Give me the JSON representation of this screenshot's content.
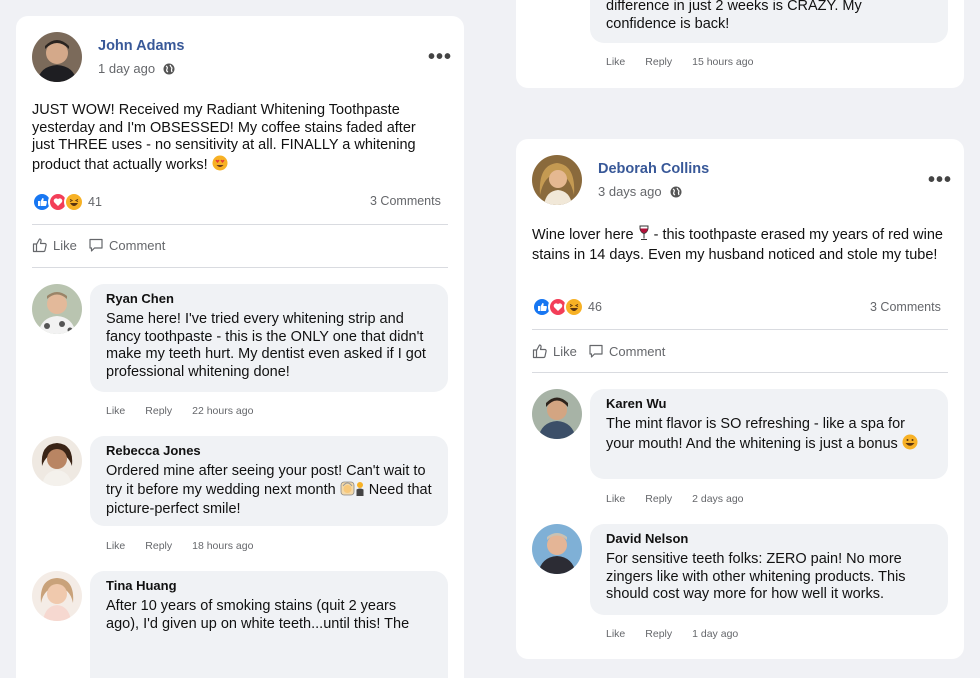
{
  "colors": {
    "author": "#385898",
    "like": "#1877f2",
    "love": "#f33e58",
    "haha": "#f7b125"
  },
  "left_post": {
    "author": "John Adams",
    "time": "1 day ago",
    "text": "JUST WOW! Received my Radiant Whitening Toothpaste yesterday and I'm OBSESSED! My coffee stains faded after just THREE uses - no sensitivity at all. FINALLY a whitening product that actually works!",
    "reaction_count": "41",
    "comments_label": "3 Comments",
    "like_label": "Like",
    "comment_label": "Comment",
    "comments": [
      {
        "name": "Ryan Chen",
        "text": "Same here! I've tried every whitening strip and fancy toothpaste - this is the ONLY one that didn't make my teeth hurt. My dentist even asked if I got professional whitening done!",
        "like": "Like",
        "reply": "Reply",
        "time": "22 hours ago"
      },
      {
        "name": "Rebecca Jones",
        "text": "Ordered mine after seeing your post! Can't wait to try it before my wedding next month",
        "text2": "Need that picture-perfect smile!",
        "like": "Like",
        "reply": "Reply",
        "time": "18 hours ago"
      },
      {
        "name": "Tina Huang",
        "text": "After 10 years of smoking stains (quit 2 years ago), I'd given up on white teeth...until this! The"
      }
    ]
  },
  "top_right_fragment": {
    "text": "difference in just 2 weeks is CRAZY. My confidence is back!",
    "like": "Like",
    "reply": "Reply",
    "time": "15 hours ago"
  },
  "right_post": {
    "author": "Deborah Collins",
    "time": "3 days ago",
    "text_before": "Wine lover here",
    "text_after": "- this toothpaste erased my years of red wine stains in 14 days. Even my husband noticed and stole my tube!",
    "reaction_count": "46",
    "comments_label": "3 Comments",
    "like_label": "Like",
    "comment_label": "Comment",
    "comments": [
      {
        "name": "Karen Wu",
        "text": "The mint flavor is SO refreshing - like a spa for your mouth! And the whitening is just a bonus",
        "like": "Like",
        "reply": "Reply",
        "time": "2 days ago"
      },
      {
        "name": "David Nelson",
        "text": "For sensitive teeth folks: ZERO pain! No more zingers like with other whitening products. This should cost way more for how well it works.",
        "like": "Like",
        "reply": "Reply",
        "time": "1 day ago"
      }
    ]
  }
}
